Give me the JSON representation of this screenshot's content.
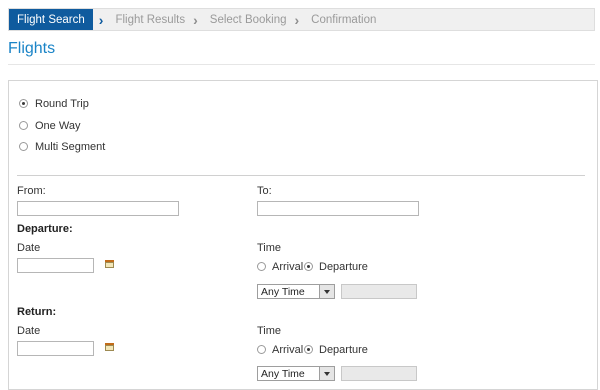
{
  "steps": {
    "flight_search": "Flight Search",
    "flight_results": "Flight Results",
    "select_booking": "Select Booking",
    "confirmation": "Confirmation"
  },
  "page": {
    "title": "Flights"
  },
  "trip_type": {
    "round_trip": "Round Trip",
    "one_way": "One Way",
    "multi_segment": "Multi Segment",
    "selected": "Round Trip"
  },
  "route": {
    "from_label": "From:",
    "from_value": "",
    "to_label": "To:",
    "to_value": ""
  },
  "departure": {
    "heading": "Departure:",
    "date_label": "Date",
    "date_value": "",
    "time_label": "Time",
    "arrival_label": "Arrival",
    "departure_label": "Departure",
    "time_select": "Any Time",
    "time_mode_selected": "Departure"
  },
  "return": {
    "heading": "Return:",
    "date_label": "Date",
    "date_value": "",
    "time_label": "Time",
    "arrival_label": "Arrival",
    "departure_label": "Departure",
    "time_select": "Any Time",
    "time_mode_selected": "Departure"
  },
  "icons": {
    "calendar": "calendar-icon",
    "dropdown": "chevron-down-icon",
    "breadcrumb": "chevron-right-icon"
  },
  "colors": {
    "accent": "#0f5b9e",
    "title": "#1a84c7"
  }
}
